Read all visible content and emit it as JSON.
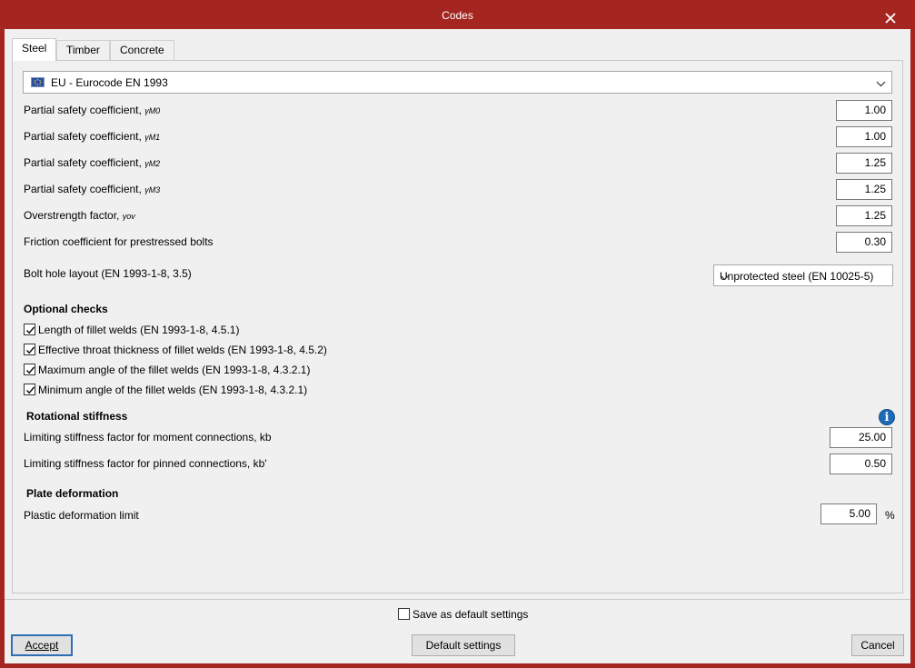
{
  "window": {
    "title": "Codes"
  },
  "tabs": [
    {
      "label": "Steel",
      "active": true
    },
    {
      "label": "Timber",
      "active": false
    },
    {
      "label": "Concrete",
      "active": false
    }
  ],
  "code_selector": {
    "flag": "eu-flag-icon",
    "value": "EU  -  Eurocode EN 1993"
  },
  "coefficients": [
    {
      "label": "Partial safety coefficient, ",
      "symbol": "γ",
      "sub": "M0",
      "value": "1.00"
    },
    {
      "label": "Partial safety coefficient, ",
      "symbol": "γ",
      "sub": "M1",
      "value": "1.00"
    },
    {
      "label": "Partial safety coefficient, ",
      "symbol": "γ",
      "sub": "M2",
      "value": "1.25"
    },
    {
      "label": "Partial safety coefficient, ",
      "symbol": "γ",
      "sub": "M3",
      "value": "1.25"
    },
    {
      "label": "Overstrength factor, ",
      "symbol": "γ",
      "sub": "ov",
      "value": "1.25"
    },
    {
      "label": "Friction coefficient for prestressed bolts",
      "symbol": "",
      "sub": "",
      "value": "0.30"
    }
  ],
  "bolt_hole": {
    "label": "Bolt hole layout (EN 1993-1-8, 3.5)",
    "value": "Unprotected steel (EN 10025-5)"
  },
  "optional_checks": {
    "title": "Optional checks",
    "items": [
      {
        "label": "Length of fillet welds (EN 1993-1-8, 4.5.1)",
        "checked": true
      },
      {
        "label": "Effective throat thickness of fillet welds (EN 1993-1-8, 4.5.2)",
        "checked": true
      },
      {
        "label": "Maximum angle of the fillet welds (EN 1993-1-8, 4.3.2.1)",
        "checked": true
      },
      {
        "label": "Minimum angle of the fillet welds (EN 1993-1-8, 4.3.2.1)",
        "checked": true
      }
    ]
  },
  "rotational_stiffness": {
    "title": "Rotational stiffness",
    "moment": {
      "label": "Limiting stiffness factor for moment connections, kb",
      "value": "25.00"
    },
    "pinned": {
      "label": "Limiting stiffness factor for pinned connections, kb'",
      "value": "0.50"
    }
  },
  "plate_deformation": {
    "title": "Plate deformation",
    "limit": {
      "label": "Plastic deformation limit",
      "value": "5.00",
      "unit": "%"
    }
  },
  "footer": {
    "save_default_label": "Save as default settings",
    "save_default_checked": false,
    "accept_label": "Accept",
    "default_settings_label": "Default settings",
    "cancel_label": "Cancel"
  }
}
